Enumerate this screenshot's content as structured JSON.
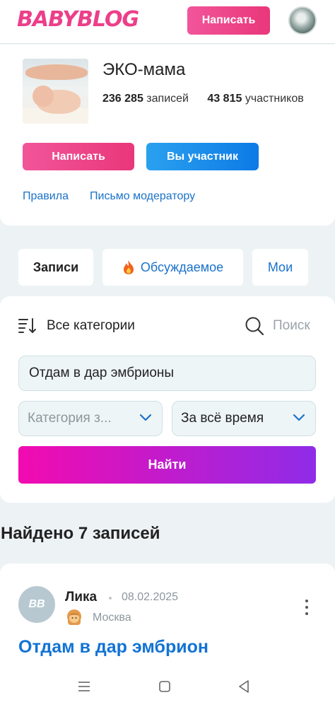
{
  "header": {
    "logo": "BABYBLOG",
    "write_label": "Написать"
  },
  "community": {
    "title": "ЭКО-мама",
    "posts_count": "236 285",
    "posts_label": "записей",
    "members_count": "43 815",
    "members_label": "участников",
    "write_label": "Написать",
    "member_label": "Вы участник",
    "rules_label": "Правила",
    "moderator_label": "Письмо модератору"
  },
  "tabs": [
    {
      "label": "Записи",
      "active": true
    },
    {
      "label": "Обсуждаемое",
      "icon": "fire-icon"
    },
    {
      "label": "Мои"
    }
  ],
  "filters": {
    "categories_label": "Все категории",
    "search_label": "Поиск",
    "query_value": "Отдам в дар эмбрионы",
    "category_placeholder": "Категория з...",
    "period_value": "За всё время",
    "find_label": "Найти"
  },
  "results": {
    "found_label": "Найдено 7 записей"
  },
  "post": {
    "avatar_initials": "BB",
    "author": "Лика",
    "date": "08.02.2025",
    "city": "Москва",
    "title": "Отдам в дар эмбрион"
  },
  "colors": {
    "brand_pink": "#ec3f8a",
    "accent_blue": "#1a72c9",
    "find_gradient_start": "#f20bb0",
    "find_gradient_end": "#8f2ce8"
  }
}
